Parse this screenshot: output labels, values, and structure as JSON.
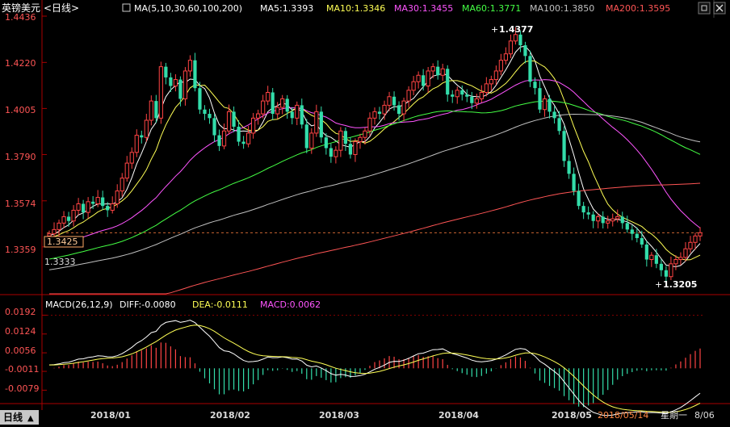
{
  "header": {
    "symbol": "英镑美元",
    "period": "<日线>",
    "ma_label": "MA(5,10,30,60,100,200)",
    "ma_values": [
      {
        "text": "MA5:1.3393",
        "color": "#ffffff"
      },
      {
        "text": "MA10:1.3346",
        "color": "#ffff55"
      },
      {
        "text": "MA30:1.3455",
        "color": "#ff55ff"
      },
      {
        "text": "MA60:1.3771",
        "color": "#44ff44"
      },
      {
        "text": "MA100:1.3850",
        "color": "#c0c0c0"
      },
      {
        "text": "MA200:1.3595",
        "color": "#ff5555"
      }
    ]
  },
  "price_axis": {
    "ticks": [
      "1.4436",
      "1.4220",
      "1.4005",
      "1.3790",
      "1.3574",
      "1.3359"
    ],
    "min": 1.3155,
    "max": 1.4436
  },
  "price_labels": {
    "last": "1.3425",
    "prev": "1.3333",
    "high": "1.4377",
    "low": "1.3205"
  },
  "macd": {
    "title": "MACD(26,12,9)",
    "diff": "DIFF:-0.0080",
    "dea": "DEA:-0.0111",
    "macd": "MACD:0.0062",
    "ticks": [
      "0.0192",
      "0.0124",
      "0.0056",
      "-0.0011",
      "-0.0079"
    ]
  },
  "x_axis": {
    "labels": [
      "2018/01",
      "2018/02",
      "2018/03",
      "2018/04",
      "2018/05"
    ],
    "cursor_date": "2018/05/14",
    "weekday": "星期一",
    "end_date": "8/06"
  },
  "footer": {
    "tab": "日线",
    "arrow": "▲"
  },
  "colors": {
    "up": "#ff4444",
    "down": "#33ddaa",
    "grid": "#800000",
    "axis": "#aa0000",
    "ma5": "#ffffff",
    "ma10": "#ffff55",
    "ma30": "#ff55ff",
    "ma60": "#44ff44",
    "ma100": "#c0c0c0",
    "ma200": "#ff5555"
  },
  "icons": {
    "window_controls": [
      "restore-icon",
      "close-icon"
    ]
  },
  "chart_data": [
    {
      "type": "candlestick",
      "title": "英镑美元<日线>",
      "x_labels": [
        "2018/01",
        "2018/02",
        "2018/03",
        "2018/04",
        "2018/05"
      ],
      "ylim": [
        1.3155,
        1.4436
      ],
      "closes": [
        1.342,
        1.344,
        1.347,
        1.35,
        1.348,
        1.353,
        1.356,
        1.352,
        1.357,
        1.356,
        1.359,
        1.355,
        1.353,
        1.356,
        1.362,
        1.368,
        1.375,
        1.38,
        1.388,
        1.387,
        1.395,
        1.404,
        1.396,
        1.42,
        1.415,
        1.411,
        1.414,
        1.405,
        1.418,
        1.423,
        1.41,
        1.4,
        1.398,
        1.396,
        1.388,
        1.383,
        1.39,
        1.399,
        1.392,
        1.385,
        1.384,
        1.389,
        1.396,
        1.398,
        1.404,
        1.408,
        1.398,
        1.401,
        1.405,
        1.399,
        1.396,
        1.402,
        1.393,
        1.382,
        1.389,
        1.399,
        1.387,
        1.382,
        1.378,
        1.381,
        1.39,
        1.384,
        1.379,
        1.385,
        1.387,
        1.39,
        1.396,
        1.399,
        1.398,
        1.402,
        1.406,
        1.402,
        1.398,
        1.404,
        1.409,
        1.413,
        1.416,
        1.411,
        1.418,
        1.42,
        1.416,
        1.419,
        1.407,
        1.406,
        1.409,
        1.407,
        1.406,
        1.403,
        1.405,
        1.408,
        1.412,
        1.414,
        1.418,
        1.423,
        1.426,
        1.432,
        1.435,
        1.43,
        1.425,
        1.413,
        1.41,
        1.4,
        1.405,
        1.399,
        1.396,
        1.39,
        1.376,
        1.37,
        1.362,
        1.355,
        1.352,
        1.351,
        1.348,
        1.35,
        1.347,
        1.348,
        1.349,
        1.35,
        1.347,
        1.344,
        1.342,
        1.34,
        1.337,
        1.33,
        1.332,
        1.328,
        1.325,
        1.322,
        1.328,
        1.33,
        1.331,
        1.335,
        1.338,
        1.341,
        1.3425
      ],
      "ma_series": [
        {
          "name": "MA5",
          "value": "1.3393"
        },
        {
          "name": "MA10",
          "value": "1.3346"
        },
        {
          "name": "MA30",
          "value": "1.3455"
        },
        {
          "name": "MA60",
          "value": "1.3771"
        },
        {
          "name": "MA100",
          "value": "1.3850"
        },
        {
          "name": "MA200",
          "value": "1.3595"
        }
      ],
      "annotations": {
        "high": 1.4377,
        "low": 1.3205,
        "last": 1.3425,
        "prev": 1.3333
      }
    },
    {
      "type": "bar",
      "title": "MACD(26,12,9)",
      "ylim": [
        -0.011,
        0.0205
      ],
      "diff": -0.008,
      "dea": -0.0111,
      "macd": 0.0062
    }
  ]
}
